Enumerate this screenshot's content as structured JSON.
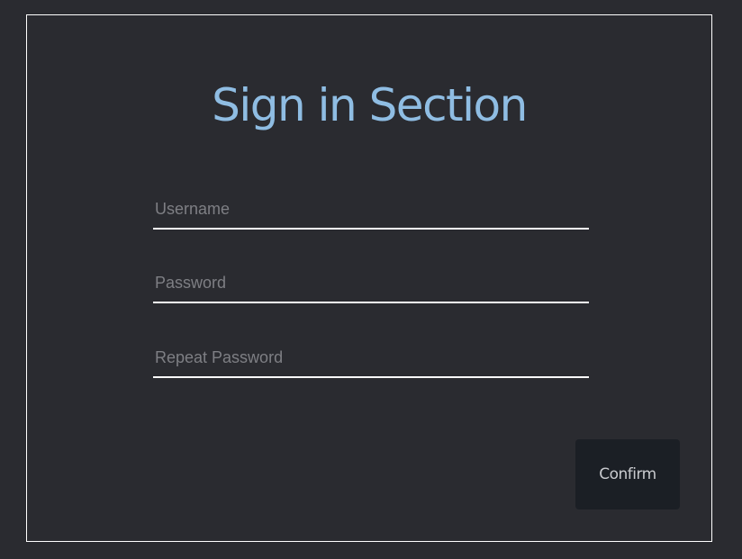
{
  "form": {
    "title": "Sign in Section",
    "fields": [
      {
        "placeholder": "Username",
        "value": ""
      },
      {
        "placeholder": "Password",
        "value": ""
      },
      {
        "placeholder": "Repeat Password",
        "value": ""
      }
    ],
    "confirm_label": "Confirm"
  },
  "colors": {
    "background": "#2a2b30",
    "title": "#8fbde3",
    "button_bg": "#1b1f25",
    "underline": "#ffffff"
  }
}
